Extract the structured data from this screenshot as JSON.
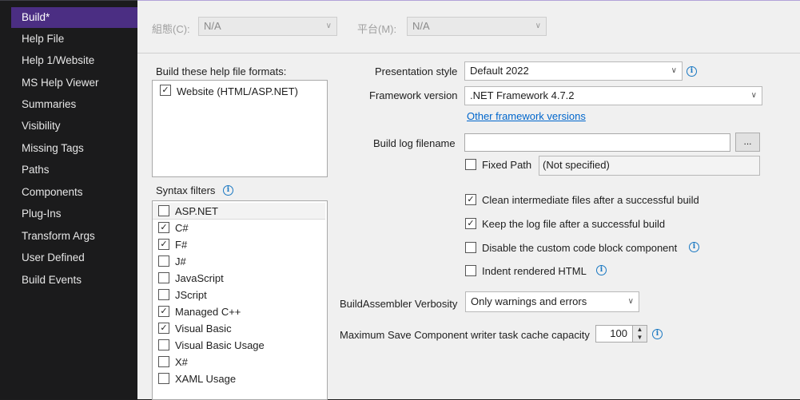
{
  "sidebar": {
    "items": [
      {
        "label": "Build*"
      },
      {
        "label": "Help File"
      },
      {
        "label": "Help 1/Website"
      },
      {
        "label": "MS Help Viewer"
      },
      {
        "label": "Summaries"
      },
      {
        "label": "Visibility"
      },
      {
        "label": "Missing Tags"
      },
      {
        "label": "Paths"
      },
      {
        "label": "Components"
      },
      {
        "label": "Plug-Ins"
      },
      {
        "label": "Transform Args"
      },
      {
        "label": "User Defined"
      },
      {
        "label": "Build Events"
      }
    ],
    "active_index": 0
  },
  "topbar": {
    "configuration_label": "組態(C):",
    "configuration_value": "N/A",
    "platform_label": "平台(M):",
    "platform_value": "N/A"
  },
  "formats": {
    "heading": "Build these help file formats:",
    "items": [
      {
        "label": "Website (HTML/ASP.NET)",
        "checked": true
      }
    ]
  },
  "syntax": {
    "heading": "Syntax filters",
    "items": [
      {
        "label": "ASP.NET",
        "checked": false
      },
      {
        "label": "C#",
        "checked": true
      },
      {
        "label": "F#",
        "checked": true
      },
      {
        "label": "J#",
        "checked": false
      },
      {
        "label": "JavaScript",
        "checked": false
      },
      {
        "label": "JScript",
        "checked": false
      },
      {
        "label": "Managed C++",
        "checked": true
      },
      {
        "label": "Visual Basic",
        "checked": true
      },
      {
        "label": "Visual Basic Usage",
        "checked": false
      },
      {
        "label": "X#",
        "checked": false
      },
      {
        "label": "XAML Usage",
        "checked": false
      }
    ]
  },
  "settings": {
    "presentation_style_label": "Presentation style",
    "presentation_style_value": "Default 2022",
    "framework_version_label": "Framework version",
    "framework_version_value": ".NET Framework 4.7.2",
    "other_framework_link": "Other framework versions",
    "build_log_label": "Build log filename",
    "build_log_value": "",
    "browse_button": "...",
    "fixed_path_label": "Fixed Path",
    "fixed_path_checked": false,
    "fixed_path_value": "(Not specified)",
    "clean_intermediate_label": "Clean intermediate files after a successful build",
    "clean_intermediate_checked": true,
    "keep_log_label": "Keep the log file after a successful build",
    "keep_log_checked": true,
    "disable_code_block_label": "Disable the custom code block component",
    "disable_code_block_checked": false,
    "indent_html_label": "Indent rendered HTML",
    "indent_html_checked": false,
    "verbosity_label": "BuildAssembler Verbosity",
    "verbosity_value": "Only warnings and errors",
    "cache_capacity_label": "Maximum Save Component writer task cache capacity",
    "cache_capacity_value": "100"
  },
  "icons": {
    "info": "info-icon",
    "dropdown": "chevron-down-icon",
    "check": "checkmark-icon"
  },
  "colors": {
    "sidebar_bg": "#1b1b1c",
    "active_item": "#4b2e83",
    "content_bg": "#f0f0f0",
    "link": "#0066cc",
    "info": "#1a78c2"
  }
}
